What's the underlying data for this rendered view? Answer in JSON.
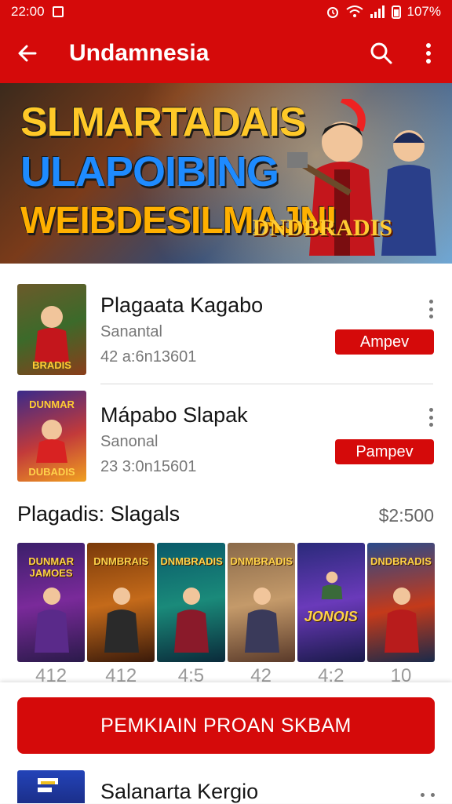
{
  "status": {
    "time": "22:00",
    "battery": "107%"
  },
  "app_bar": {
    "title": "Undamnesia"
  },
  "banner": {
    "line1": "SLMARTADAIS",
    "line2": "ULAPOIBING",
    "line3": "WEIBDESILMAJNI",
    "logo": "DNDBRADIS"
  },
  "items": [
    {
      "title": "Plagaata Kagabo",
      "subtitle": "Sanantal",
      "meta": "42 a:6n13601",
      "button": "Ampev"
    },
    {
      "title": "Mápabo Slapak",
      "subtitle": "Sanonal",
      "meta": "23 3:0n15601",
      "button": "Pampev"
    }
  ],
  "section": {
    "title": "Plagadis: Slagals",
    "price": "$2:500",
    "cards": [
      {
        "title": "DUNMAR\nJAMOES"
      },
      {
        "title": "DNMBRAIS"
      },
      {
        "title": "DNMBRADIS"
      },
      {
        "title": "DNMBRADIS"
      },
      {
        "title": "JONOIS"
      },
      {
        "title": "DNDBRADIS"
      }
    ],
    "counts": [
      "412",
      "412",
      "4:5",
      "42",
      "4:2",
      "10"
    ]
  },
  "cta": {
    "label": "PEMKIAIN PROAN SKBAM"
  },
  "bottom_item": {
    "title": "Salanarta Kergio"
  },
  "colors": {
    "brand_red": "#d50a0a"
  }
}
